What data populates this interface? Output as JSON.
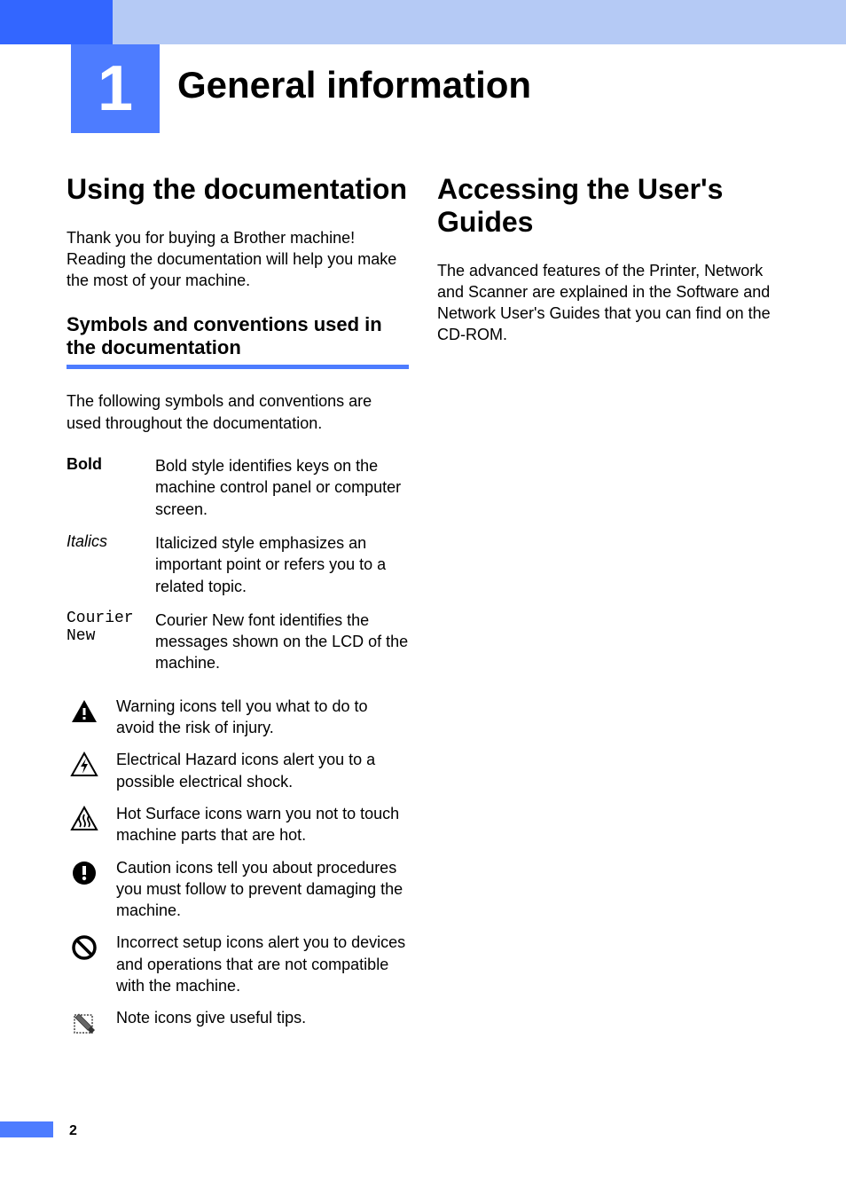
{
  "chapter": {
    "number": "1",
    "title": "General information"
  },
  "left_col": {
    "heading": "Using the documentation",
    "intro": "Thank you for buying a Brother machine! Reading the documentation will help you make the most of your machine.",
    "subsection": {
      "heading": "Symbols and conventions used in the documentation",
      "intro": "The following symbols and conventions are used throughout the documentation."
    },
    "defs": [
      {
        "label": "Bold",
        "style": "bold",
        "text": "Bold style identifies keys on the machine control panel or computer screen."
      },
      {
        "label": "Italics",
        "style": "italic",
        "text": "Italicized style emphasizes an important point or refers you to a related topic."
      },
      {
        "label": "Courier New",
        "style": "mono",
        "text": "Courier New font identifies the messages shown on the LCD of the machine."
      }
    ],
    "icons": [
      {
        "name": "warning-icon",
        "text": "Warning icons tell you what to do to avoid the risk of injury."
      },
      {
        "name": "electrical-hazard-icon",
        "text": "Electrical Hazard icons alert you to a possible electrical shock."
      },
      {
        "name": "hot-surface-icon",
        "text": "Hot Surface icons warn you not to touch machine parts that are hot."
      },
      {
        "name": "caution-icon",
        "text": "Caution icons tell you about procedures you must follow to prevent damaging the machine."
      },
      {
        "name": "incorrect-setup-icon",
        "text": "Incorrect setup icons alert you to devices and operations that are not compatible with the machine."
      },
      {
        "name": "note-icon",
        "text": "Note icons give useful tips."
      }
    ]
  },
  "right_col": {
    "heading": "Accessing the User's Guides",
    "intro": "The advanced features of the Printer, Network and Scanner are explained in the Software and Network User's Guides that you can find on the CD-ROM."
  },
  "page_number": "2"
}
